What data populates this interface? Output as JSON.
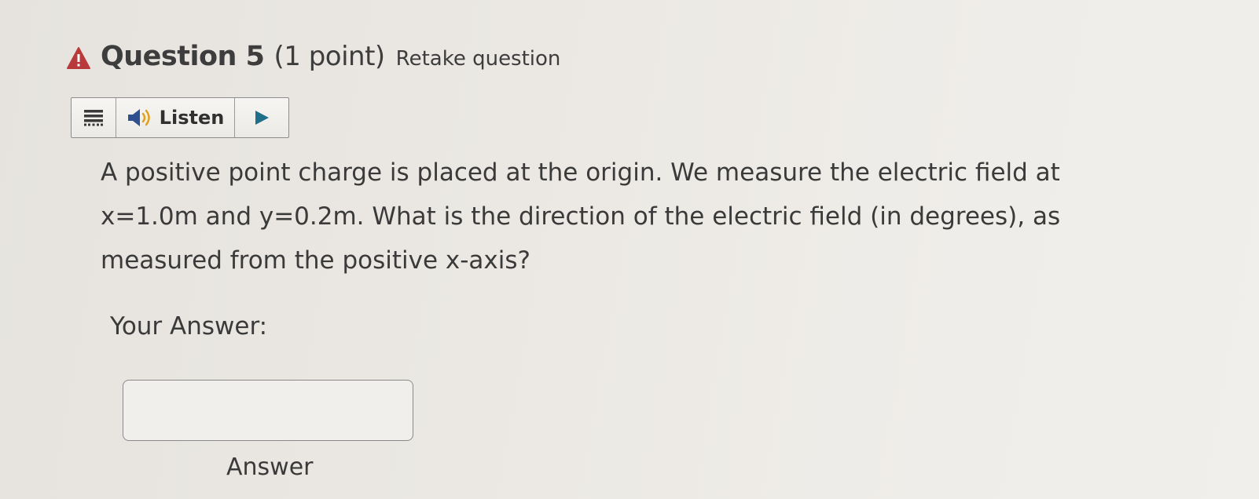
{
  "question": {
    "warning_icon": "warning-triangle-icon",
    "title": "Question 5",
    "points": "(1 point)",
    "retake_label": "Retake question",
    "text": "A positive point charge is placed at the origin. We measure the electric field at x=1.0m and y=0.2m. What is the direction of the electric field (in degrees), as measured from the positive x-axis?"
  },
  "listen_toolbar": {
    "menu_icon": "menu-icon",
    "speaker_icon": "speaker-icon",
    "listen_label": "Listen",
    "play_icon": "play-icon"
  },
  "answer": {
    "label": "Your Answer:",
    "value": "",
    "placeholder": "",
    "caption": "Answer"
  },
  "colors": {
    "warning": "#b93a3a",
    "play": "#1f6f8b",
    "background": "#ebe8e3"
  }
}
